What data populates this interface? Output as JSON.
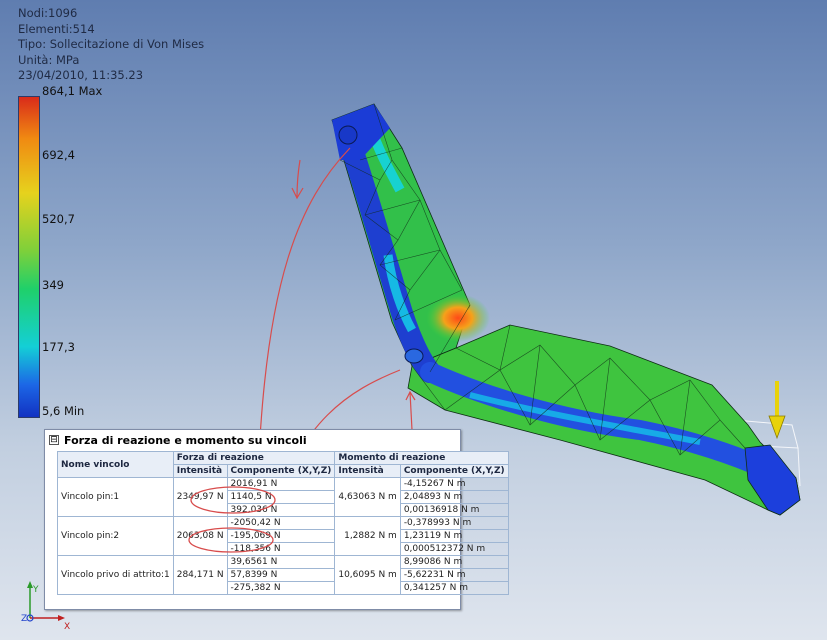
{
  "info": {
    "nodes": "Nodi:1096",
    "elements": "Elementi:514",
    "type": "Tipo: Sollecitazione di Von Mises",
    "unit": "Unità: MPa",
    "date": "23/04/2010, 11:35.23"
  },
  "legend": {
    "max": "864,1 Max",
    "v692": "692,4",
    "v520": "520,7",
    "v349": "349",
    "v177": "177,3",
    "min": "5,6 Min"
  },
  "triad": {
    "x": "X",
    "y": "Y",
    "z": "Z"
  },
  "panel": {
    "collapse": "⊟",
    "title": "Forza di reazione e momento su vincoli",
    "headers": {
      "name": "Nome vincolo",
      "force_group": "Forza di reazione",
      "moment_group": "Momento di reazione",
      "intensity": "Intensità",
      "component": "Componente (X,Y,Z)",
      "m_intensity": "Intensità",
      "m_component": "Componente (X,Y,Z)"
    },
    "rows": [
      {
        "name": "Vincolo pin:1",
        "f_int": "2349,97 N",
        "f_comp": [
          "2016,91 N",
          "1140,5 N",
          "392,036 N"
        ],
        "m_int": "4,63063 N m",
        "m_comp": [
          "-4,15267 N m",
          "2,04893 N m",
          "0,00136918 N m"
        ]
      },
      {
        "name": "Vincolo pin:2",
        "f_int": "2063,08 N",
        "f_comp": [
          "-2050,42 N",
          "-195,069 N",
          "-118,356 N"
        ],
        "m_int": "1,2882 N m",
        "m_comp": [
          "-0,378993 N m",
          "1,23119 N m",
          "0,000512372 N m"
        ]
      },
      {
        "name": "Vincolo privo di attrito:1",
        "f_int": "284,171 N",
        "f_comp": [
          "39,6561 N",
          "57,8399 N",
          "-275,382 N"
        ],
        "m_int": "10,6095 N m",
        "m_comp": [
          "8,99086 N m",
          "-5,62231 N m",
          "0,341257 N m"
        ]
      }
    ]
  }
}
